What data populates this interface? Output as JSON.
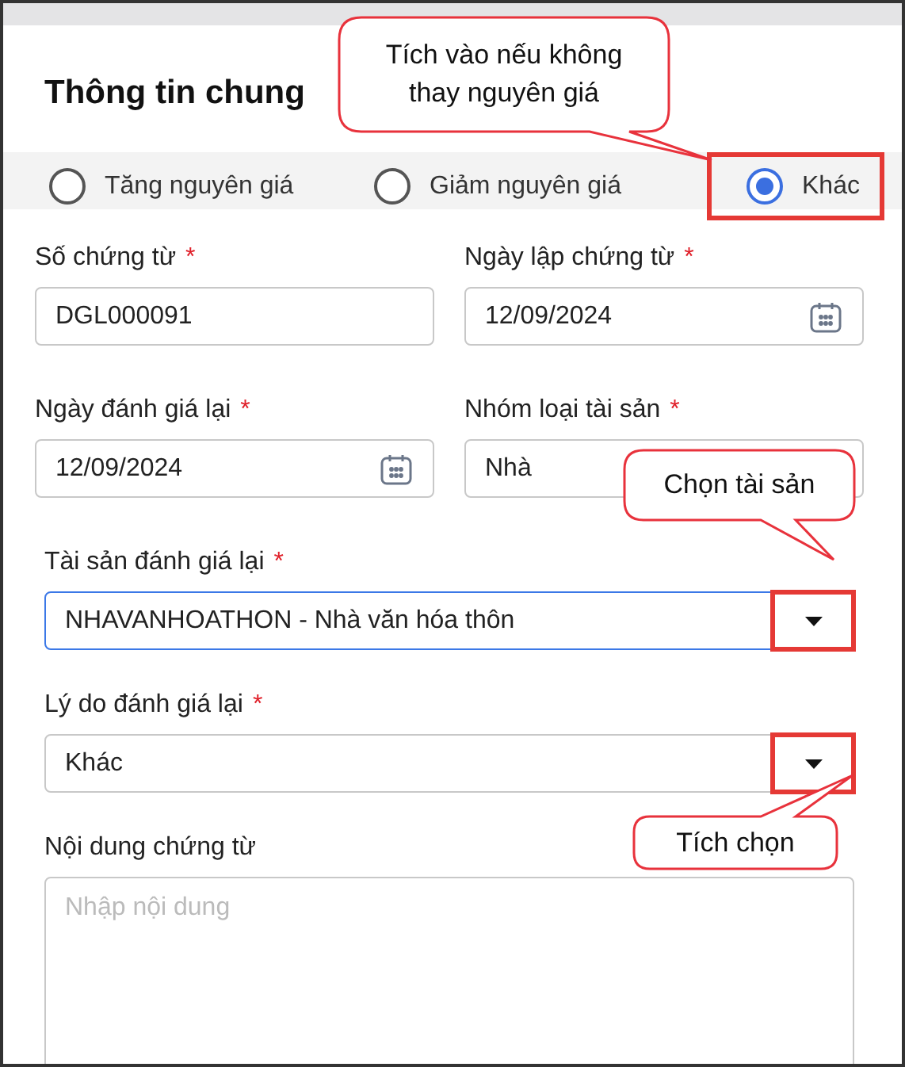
{
  "title": "Thông tin chung",
  "radios": [
    {
      "label": "Tăng nguyên giá",
      "selected": false,
      "highlighted": false
    },
    {
      "label": "Giảm nguyên giá",
      "selected": false,
      "highlighted": false
    },
    {
      "label": "Khác",
      "selected": true,
      "highlighted": true
    }
  ],
  "field_rows": [
    [
      {
        "kind": "text",
        "label": "Số chứng từ",
        "required": "*",
        "value": "DGL000091"
      },
      {
        "kind": "date",
        "label": "Ngày lập chứng từ",
        "required": "*",
        "value": "12/09/2024"
      }
    ],
    [
      {
        "kind": "date",
        "label": "Ngày đánh giá lại",
        "required": "*",
        "value": "12/09/2024"
      },
      {
        "kind": "text",
        "label": "Nhóm loại tài sản",
        "required": "*",
        "value": "Nhà"
      }
    ]
  ],
  "wide_fields": [
    {
      "kind": "select",
      "label": "Tài sản đánh giá lại",
      "required": "*",
      "value": "NHAVANHOATHON - Nhà văn hóa thôn",
      "focused": true,
      "highlighted": true
    },
    {
      "kind": "select",
      "label": "Lý do đánh giá lại",
      "required": "*",
      "value": "Khác",
      "focused": false,
      "highlighted": true
    },
    {
      "kind": "textarea",
      "label": "Nội dung chứng từ",
      "placeholder": "Nhập nội dung"
    }
  ],
  "callouts": [
    {
      "text": "Tích vào nếu không thay nguyên giá"
    },
    {
      "text": "Chọn tài sản"
    },
    {
      "text": "Tích chọn"
    }
  ]
}
